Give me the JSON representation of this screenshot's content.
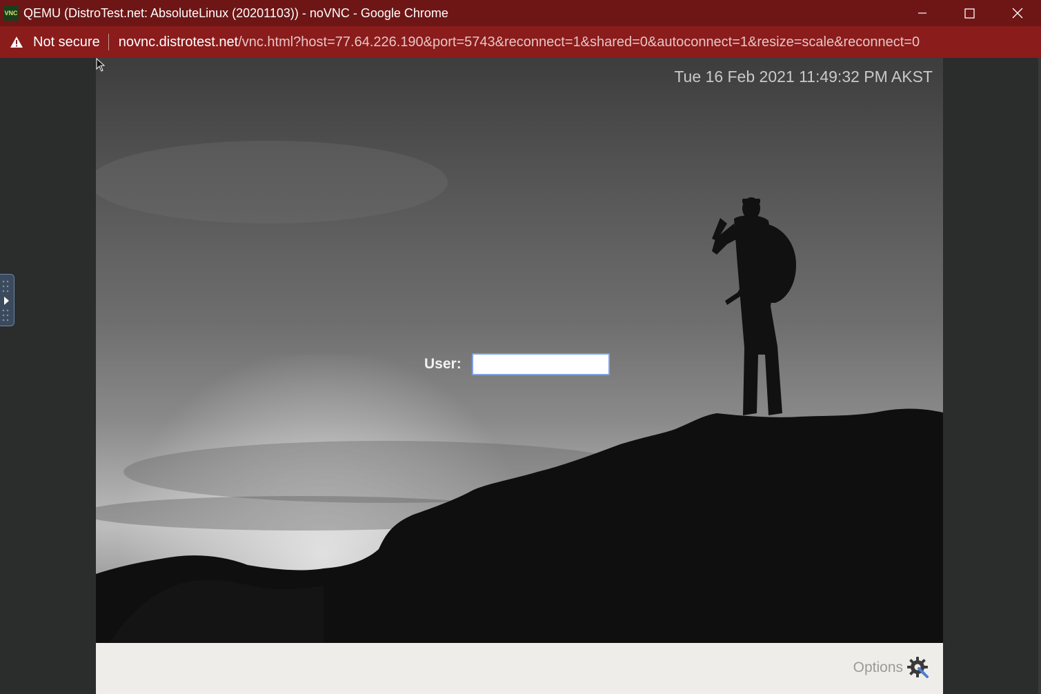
{
  "window": {
    "title": "QEMU (DistroTest.net: AbsoluteLinux (20201103)) - noVNC - Google Chrome",
    "app_icon_text": "VNC"
  },
  "addressbar": {
    "security_label": "Not secure",
    "url_host": "novnc.distrotest.net",
    "url_path": "/vnc.html?host=77.64.226.190&port=5743&reconnect=1&shared=0&autoconnect=1&resize=scale&reconnect=0"
  },
  "vnc": {
    "clock": "Tue 16 Feb 2021 11:49:32 PM AKST",
    "login": {
      "user_label": "User:",
      "user_value": ""
    },
    "options_label": "Options"
  },
  "colors": {
    "titlebar": "#6e1616",
    "addressbar": "#8a1c1c",
    "panel": "#efedea"
  }
}
